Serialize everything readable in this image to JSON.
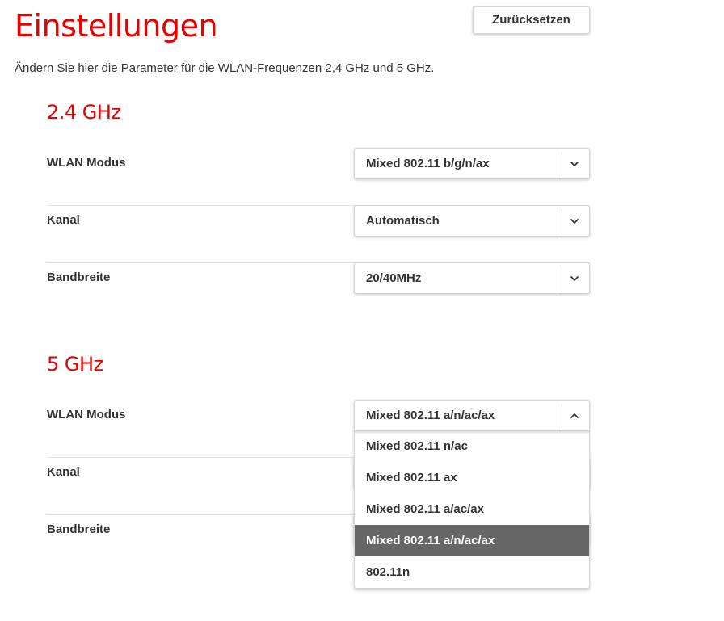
{
  "page": {
    "title": "Einstellungen",
    "reset_label": "Zurücksetzen",
    "intro": "Ändern Sie hier die Parameter für die WLAN-Frequenzen 2,4 GHz und 5 GHz."
  },
  "band24": {
    "title": "2.4 GHz",
    "rows": [
      {
        "label": "WLAN Modus",
        "value": "Mixed 802.11 b/g/n/ax"
      },
      {
        "label": "Kanal",
        "value": "Automatisch"
      },
      {
        "label": "Bandbreite",
        "value": "20/40MHz"
      }
    ]
  },
  "band5": {
    "title": "5 GHz",
    "rows": [
      {
        "label": "WLAN Modus",
        "value": "Mixed 802.11 a/n/ac/ax",
        "open": true
      },
      {
        "label": "Kanal"
      },
      {
        "label": "Bandbreite"
      }
    ],
    "mode_options": [
      "Mixed 802.11 n/ac",
      "Mixed 802.11 ax",
      "Mixed 802.11 a/ac/ax",
      "Mixed 802.11 a/n/ac/ax",
      "802.11n"
    ],
    "mode_selected_index": 3
  },
  "icons": {
    "collapsed": "chevron-down-icon",
    "expanded": "chevron-up-icon"
  },
  "colors": {
    "accent": "#e60000",
    "text": "#333333",
    "selected_bg": "#666666"
  }
}
